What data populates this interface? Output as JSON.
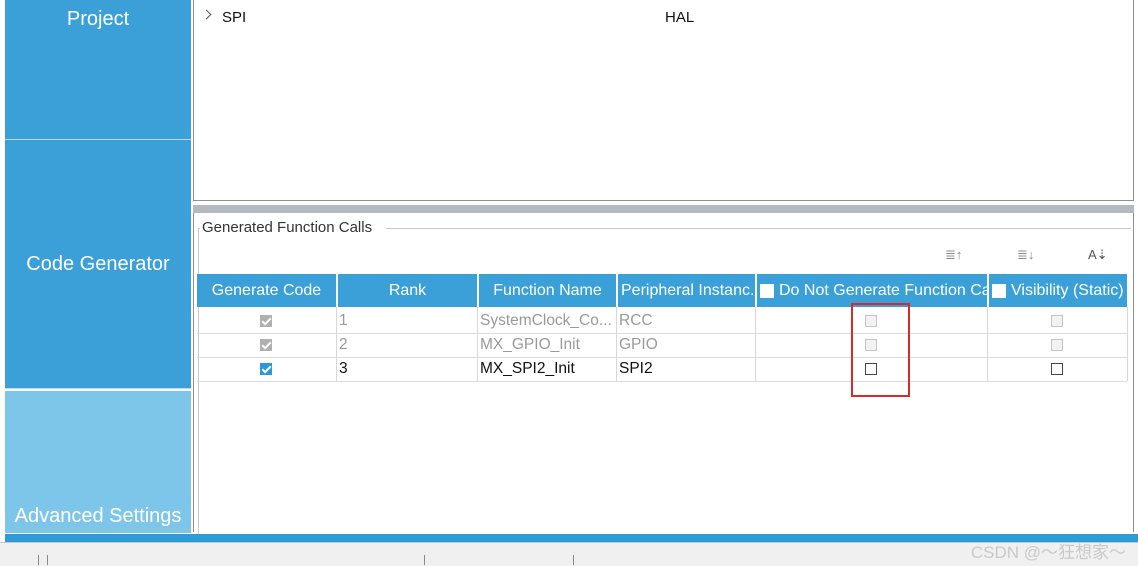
{
  "sidebar": {
    "project": "Project",
    "code_generator": "Code Generator",
    "advanced_settings": "Advanced Settings"
  },
  "driver_tree": {
    "row": {
      "label": "SPI",
      "value": "HAL"
    }
  },
  "function_calls": {
    "group_title": "Generated Function Calls",
    "headers": [
      "Generate Code",
      "Rank",
      "Function Name",
      "Peripheral Instanc...",
      "Do Not Generate Function Call",
      "Visibility (Static)"
    ],
    "rows": [
      {
        "rank": "1",
        "function": "SystemClock_Co...",
        "peripheral": "RCC",
        "generate_code": true,
        "do_not_generate": false,
        "visibility": false,
        "enabled": false
      },
      {
        "rank": "2",
        "function": "MX_GPIO_Init",
        "peripheral": "GPIO",
        "generate_code": true,
        "do_not_generate": false,
        "visibility": false,
        "enabled": false
      },
      {
        "rank": "3",
        "function": "MX_SPI2_Init",
        "peripheral": "SPI2",
        "generate_code": true,
        "do_not_generate": false,
        "visibility": false,
        "enabled": true
      }
    ],
    "sort_icons": [
      "sort-ascending-icon",
      "sort-descending-icon",
      "sort-alphabetical-icon"
    ]
  },
  "watermark": "CSDN @～狂想家～",
  "colors": {
    "accent": "#3b9fd8",
    "accent_light": "#7dc6ea",
    "highlight": "#d62b2b"
  }
}
